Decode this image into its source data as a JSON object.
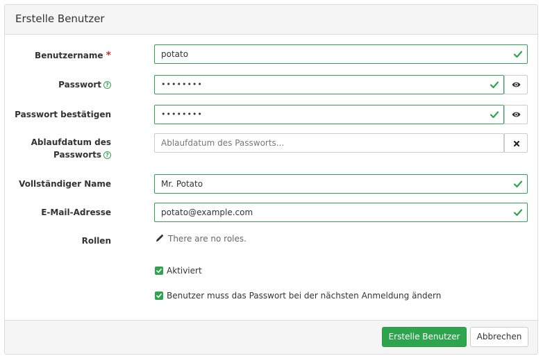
{
  "title": "Erstelle Benutzer",
  "fields": {
    "username": {
      "label": "Benutzername",
      "required_mark": "*",
      "value": "potato"
    },
    "password": {
      "label": "Passwort",
      "value": "••••••••"
    },
    "password_confirm": {
      "label": "Passwort bestätigen",
      "value": "••••••••"
    },
    "password_expiry": {
      "label_line1": "Ablaufdatum des",
      "label_line2": "Passworts",
      "placeholder": "Ablaufdatum des Passworts..."
    },
    "full_name": {
      "label": "Vollständiger Name",
      "value": "Mr. Potato"
    },
    "email": {
      "label": "E-Mail-Adresse",
      "value": "potato@example.com"
    },
    "roles": {
      "label": "Rollen",
      "empty_text": "There are no roles."
    }
  },
  "checkboxes": {
    "enabled": {
      "label": "Aktiviert",
      "checked": true
    },
    "pw_update_required": {
      "label": "Benutzer muss das Passwort bei der nächsten Anmeldung ändern",
      "checked": true
    }
  },
  "footer": {
    "submit_label": "Erstelle Benutzer",
    "cancel_label": "Abbrechen"
  },
  "icons": {
    "valid": "check-icon",
    "reveal": "eye-icon",
    "clear": "times-icon",
    "edit": "pencil-icon",
    "help": "question-circle-icon"
  },
  "colors": {
    "success": "#2ea44f",
    "required": "#c9302c",
    "header_bg": "#f5f5f5"
  }
}
